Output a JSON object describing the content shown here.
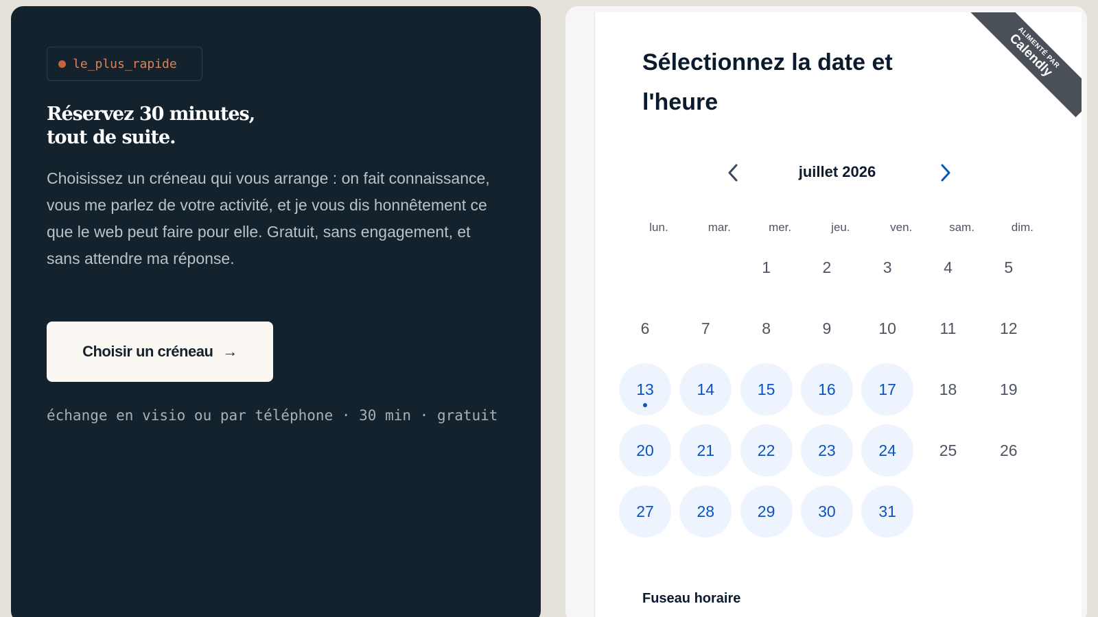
{
  "promo": {
    "tag": "le_plus_rapide",
    "headline_line1": "Réservez 30 minutes,",
    "headline_line2": "tout de suite.",
    "intro": "Choisissez un créneau qui vous arrange : on fait connaissance, vous me parlez de votre activité, et je vous dis honnêtement ce que le web peut faire pour elle. Gratuit, sans engagement, et sans attendre ma réponse.",
    "cta_label": "Choisir un créneau",
    "cta_arrow": "→",
    "subnote": "échange en visio ou par téléphone · 30 min · gratuit"
  },
  "calendly": {
    "ribbon_small": "ALIMENTÉ PAR",
    "ribbon_brand": "Calendly",
    "title": "Sélectionnez la date et l'heure",
    "month": "juillet 2026",
    "weekdays": [
      "lun.",
      "mar.",
      "mer.",
      "jeu.",
      "ven.",
      "sam.",
      "dim."
    ],
    "first_weekday_index": 2,
    "days_in_month": 31,
    "available_days": [
      13,
      14,
      15,
      16,
      17,
      20,
      21,
      22,
      23,
      24,
      27,
      28,
      29,
      30,
      31
    ],
    "today": 13,
    "timezone_label": "Fuseau horaire"
  },
  "colors": {
    "dark_bg": "#13222d",
    "accent_orange": "#d9845a",
    "calendly_blue": "#0b53c1",
    "available_bg": "#eef4fd"
  }
}
